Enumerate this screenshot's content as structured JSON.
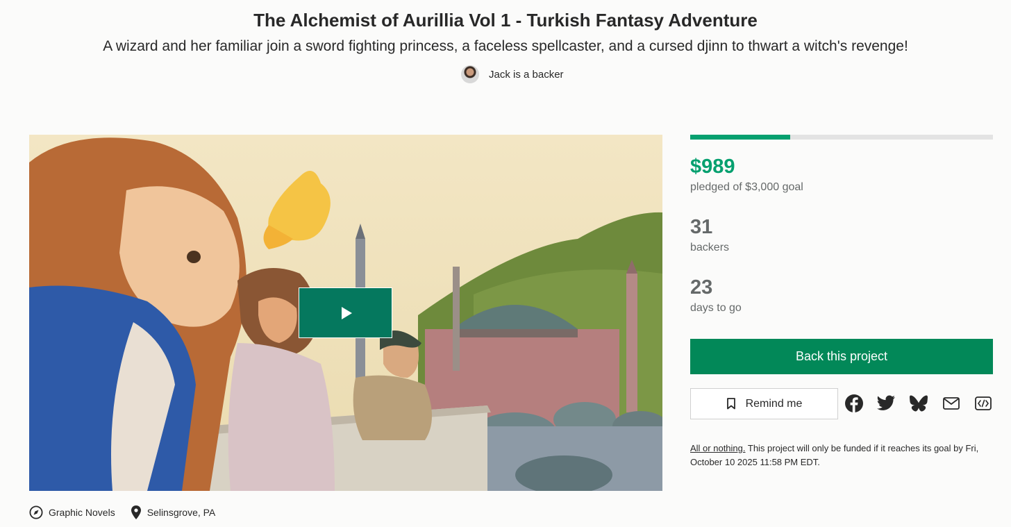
{
  "project": {
    "title": "The Alchemist of Aurillia Vol 1 - Turkish Fantasy Adventure",
    "blurb": "A wizard and her familiar join a sword fighting princess, a faceless spellcaster, and a cursed djinn to thwart a witch's revenge!",
    "backer_note": "Jack is a backer"
  },
  "funding": {
    "progress_fraction": 0.33,
    "pledged": "$989",
    "pledged_label": "pledged of $3,000 goal",
    "backers": "31",
    "backers_label": "backers",
    "days": "23",
    "days_label": "days to go",
    "back_label": "Back this project",
    "remind_label": "Remind me",
    "fine_print_link": "All or nothing.",
    "fine_print_text": " This project will only be funded if it reaches its goal by Fri, October 10 2025 11:58 PM EDT."
  },
  "share_icons": [
    "facebook-icon",
    "twitter-icon",
    "bluesky-icon",
    "email-icon",
    "embed-icon"
  ],
  "meta": {
    "category": "Graphic Novels",
    "location": "Selinsgrove, PA"
  },
  "colors": {
    "accent_green": "#05a06f",
    "button_green": "#028858",
    "play_green": "#05785e",
    "muted_text": "#656969"
  }
}
